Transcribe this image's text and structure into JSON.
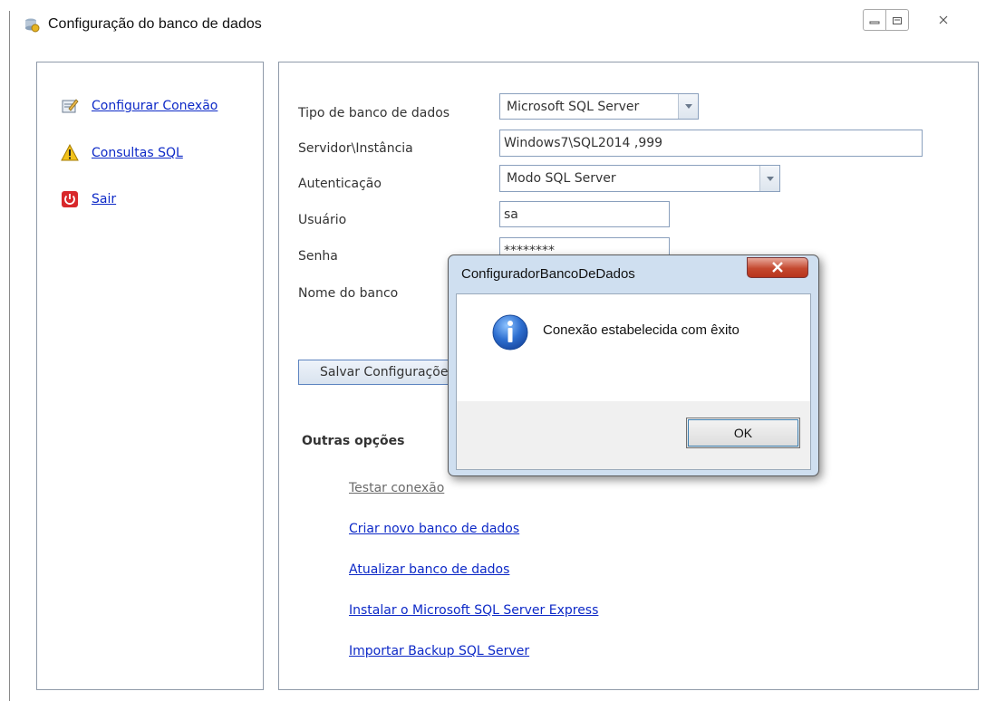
{
  "window": {
    "title": "Configuração do banco de dados",
    "icon": "database-config-icon",
    "controls": [
      "minimize-icon",
      "maximize-icon",
      "close-icon"
    ]
  },
  "sidebar": {
    "items": [
      {
        "label": "Configurar Conexão",
        "icon": "config-connection-icon"
      },
      {
        "label": "Consultas SQL",
        "icon": "warning-icon"
      },
      {
        "label": "Sair",
        "icon": "power-icon"
      }
    ]
  },
  "form": {
    "db_type": {
      "label": "Tipo de banco de dados",
      "value": "Microsoft SQL Server"
    },
    "server": {
      "label": "Servidor\\Instância",
      "value": "Windows7\\SQL2014 ,999"
    },
    "auth": {
      "label": "Autenticação",
      "value": "Modo SQL Server"
    },
    "user": {
      "label": "Usuário",
      "value": "sa"
    },
    "password": {
      "label": "Senha",
      "value": "********"
    },
    "db_name": {
      "label": "Nome do banco"
    },
    "save_label": "Salvar Configurações"
  },
  "other_options": {
    "title": "Outras opções",
    "links": [
      "Testar conexão",
      "Criar novo banco de dados",
      "Atualizar banco de dados",
      "Instalar o Microsoft SQL Server Express",
      "Importar Backup SQL Server"
    ]
  },
  "dialog": {
    "title": "ConfiguradorBancoDeDados",
    "message": "Conexão estabelecida com êxito",
    "ok_label": "OK",
    "icon": "info-icon"
  },
  "colors": {
    "link": "#0d29c7",
    "panel_border": "#8f9aa9",
    "dialog_frame": "#cfdff0",
    "close_button": "#c4482f"
  }
}
